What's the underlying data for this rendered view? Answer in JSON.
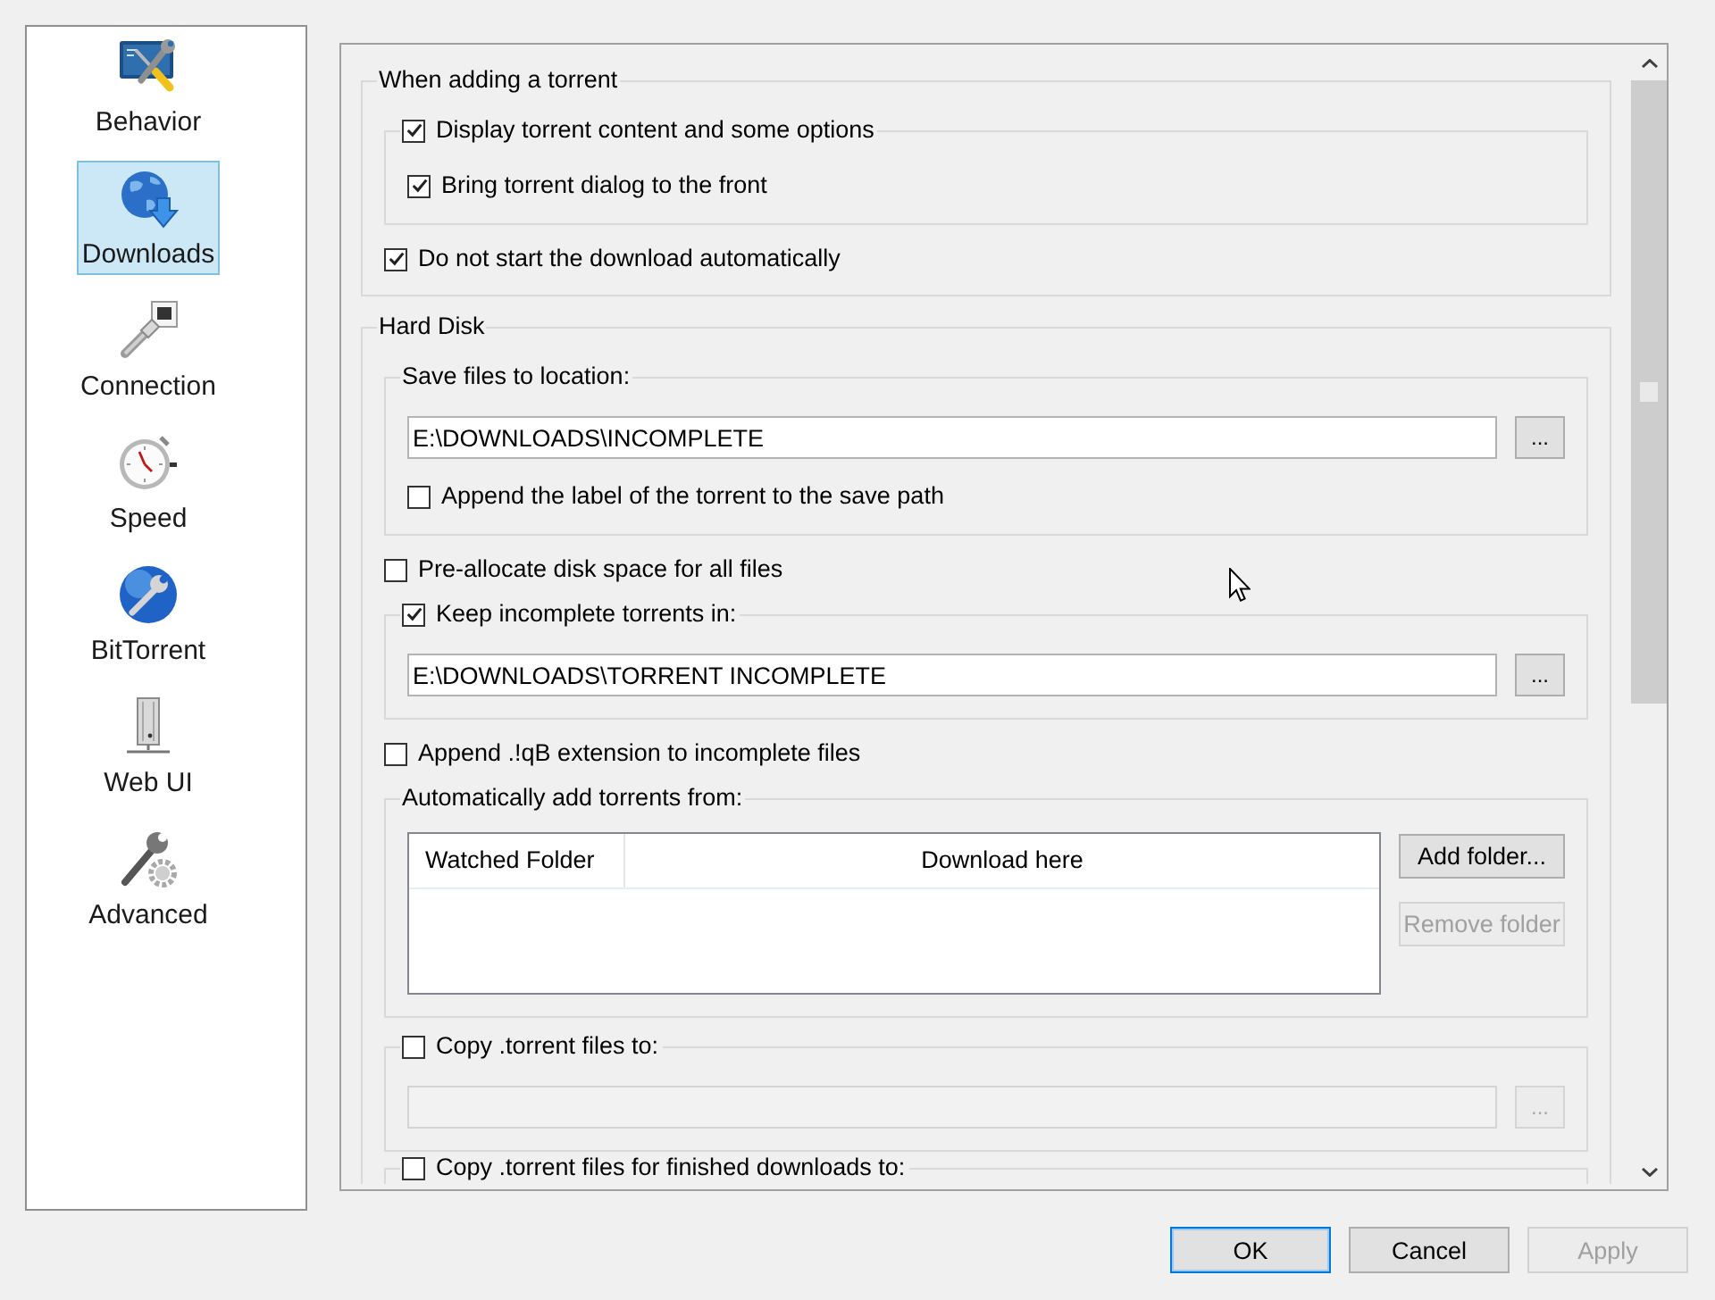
{
  "sidebar": {
    "items": [
      {
        "label": "Behavior",
        "selected": false
      },
      {
        "label": "Downloads",
        "selected": true
      },
      {
        "label": "Connection",
        "selected": false
      },
      {
        "label": "Speed",
        "selected": false
      },
      {
        "label": "BitTorrent",
        "selected": false
      },
      {
        "label": "Web UI",
        "selected": false
      },
      {
        "label": "Advanced",
        "selected": false
      }
    ]
  },
  "sections": [
    {
      "title": "When adding a torrent",
      "items": [
        {
          "kind": "check_group",
          "label": "Display torrent content and some options",
          "checked": true,
          "items": [
            {
              "kind": "checkbox",
              "label": "Bring torrent dialog to the front",
              "checked": true
            }
          ]
        },
        {
          "kind": "checkbox",
          "label": "Do not start the download automatically",
          "checked": true
        }
      ]
    },
    {
      "title": "Hard Disk",
      "items": [
        {
          "kind": "group",
          "title": "Save files to location:",
          "items": [
            {
              "kind": "path",
              "value": "E:\\DOWNLOADS\\INCOMPLETE",
              "button": "...",
              "disabled": false
            },
            {
              "kind": "checkbox",
              "label": "Append the label of the torrent to the save path",
              "checked": false
            }
          ]
        },
        {
          "kind": "checkbox",
          "label": "Pre-allocate disk space for all files",
          "checked": false
        },
        {
          "kind": "check_group",
          "label": "Keep incomplete torrents in:",
          "checked": true,
          "items": [
            {
              "kind": "path",
              "value": "E:\\DOWNLOADS\\TORRENT INCOMPLETE",
              "button": "...",
              "disabled": false
            }
          ]
        },
        {
          "kind": "checkbox",
          "label": "Append .!qB extension to incomplete files",
          "checked": false
        },
        {
          "kind": "group",
          "title": "Automatically add torrents from:",
          "items": [
            {
              "kind": "folders",
              "columns": [
                "Watched Folder",
                "Download here"
              ],
              "buttons": [
                {
                  "label": "Add folder...",
                  "disabled": false
                },
                {
                  "label": "Remove folder",
                  "disabled": true
                }
              ]
            }
          ]
        },
        {
          "kind": "check_group",
          "label": "Copy .torrent files to:",
          "checked": false,
          "items": [
            {
              "kind": "path",
              "button": "...",
              "disabled": true
            }
          ]
        },
        {
          "kind": "check_group",
          "label": "Copy .torrent files for finished downloads to:",
          "checked": false
        }
      ]
    }
  ],
  "buttons": [
    {
      "label": "OK",
      "default": true,
      "disabled": false
    },
    {
      "label": "Cancel",
      "default": false,
      "disabled": false
    },
    {
      "label": "Apply",
      "default": false,
      "disabled": true
    }
  ]
}
